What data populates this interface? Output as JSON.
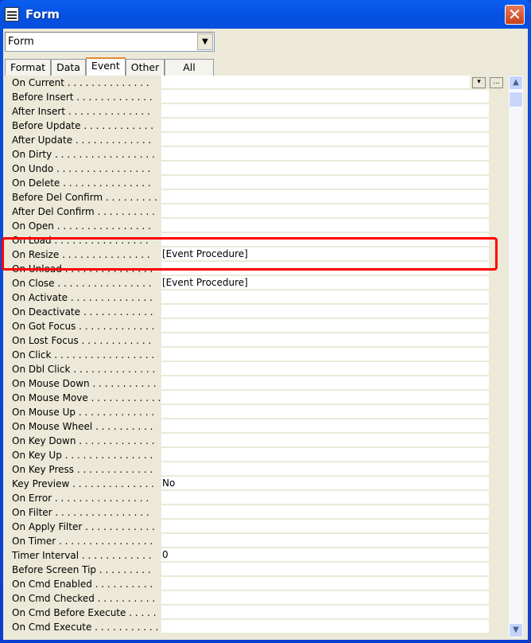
{
  "window": {
    "title": "Form",
    "close_label": "✕"
  },
  "object_combo": {
    "value": "Form"
  },
  "tabs": [
    {
      "label": "Format"
    },
    {
      "label": "Data"
    },
    {
      "label": "Event",
      "active": true
    },
    {
      "label": "Other"
    },
    {
      "label": "All"
    }
  ],
  "properties": [
    {
      "label": "On Current . . . . . . . . . . . . . .",
      "value": ""
    },
    {
      "label": "Before Insert . . . . . . . . . . . . .",
      "value": ""
    },
    {
      "label": "After Insert . . . . . . . . . . . . . .",
      "value": ""
    },
    {
      "label": "Before Update . . . . . . . . . . . .",
      "value": ""
    },
    {
      "label": "After Update . . . . . . . . . . . . .",
      "value": ""
    },
    {
      "label": "On Dirty . . . . . . . . . . . . . . . . .",
      "value": ""
    },
    {
      "label": "On Undo . . . . . . . . . . . . . . . .",
      "value": ""
    },
    {
      "label": "On Delete . . . . . . . . . . . . . . .",
      "value": ""
    },
    {
      "label": "Before Del Confirm . . . . . . . . .",
      "value": ""
    },
    {
      "label": "After Del Confirm . . . . . . . . . .",
      "value": ""
    },
    {
      "label": "On Open . . . . . . . . . . . . . . . .",
      "value": ""
    },
    {
      "label": "On Load . . . . . . . . . . . . . . . .",
      "value": ""
    },
    {
      "label": "On Resize . . . . . . . . . . . . . . .",
      "value": "[Event Procedure]"
    },
    {
      "label": "On Unload . . . . . . . . . . . . . . .",
      "value": ""
    },
    {
      "label": "On Close . . . . . . . . . . . . . . . .",
      "value": "[Event Procedure]"
    },
    {
      "label": "On Activate . . . . . . . . . . . . . .",
      "value": ""
    },
    {
      "label": "On Deactivate . . . . . . . . . . . .",
      "value": ""
    },
    {
      "label": "On Got Focus . . . . . . . . . . . . .",
      "value": ""
    },
    {
      "label": "On Lost Focus . . . . . . . . . . . .",
      "value": ""
    },
    {
      "label": "On Click . . . . . . . . . . . . . . . . .",
      "value": ""
    },
    {
      "label": "On Dbl Click . . . . . . . . . . . . . .",
      "value": ""
    },
    {
      "label": "On Mouse Down . . . . . . . . . . .",
      "value": ""
    },
    {
      "label": "On Mouse Move . . . . . . . . . . . .",
      "value": ""
    },
    {
      "label": "On Mouse Up . . . . . . . . . . . . .",
      "value": ""
    },
    {
      "label": "On Mouse Wheel . . . . . . . . . .",
      "value": ""
    },
    {
      "label": "On Key Down . . . . . . . . . . . . .",
      "value": ""
    },
    {
      "label": "On Key Up . . . . . . . . . . . . . . .",
      "value": ""
    },
    {
      "label": "On Key Press . . . . . . . . . . . . .",
      "value": ""
    },
    {
      "label": "Key Preview . . . . . . . . . . . . . .",
      "value": "No"
    },
    {
      "label": "On Error . . . . . . . . . . . . . . . .",
      "value": ""
    },
    {
      "label": "On Filter . . . . . . . . . . . . . . . .",
      "value": ""
    },
    {
      "label": "On Apply Filter . . . . . . . . . . . .",
      "value": ""
    },
    {
      "label": "On Timer . . . . . . . . . . . . . . . .",
      "value": ""
    },
    {
      "label": "Timer Interval . . . . . . . . . . . .",
      "value": "0"
    },
    {
      "label": "Before Screen Tip . . . . . . . . .",
      "value": ""
    },
    {
      "label": "On Cmd Enabled . . . . . . . . . .",
      "value": ""
    },
    {
      "label": "On Cmd Checked . . . . . . . . . .",
      "value": ""
    },
    {
      "label": "On Cmd Before Execute . . . . .",
      "value": ""
    },
    {
      "label": "On Cmd Execute . . . . . . . . . . .",
      "value": ""
    }
  ],
  "row_buttons": {
    "dropdown": "▾",
    "builder": "..."
  },
  "highlight_color": "#ff0000"
}
